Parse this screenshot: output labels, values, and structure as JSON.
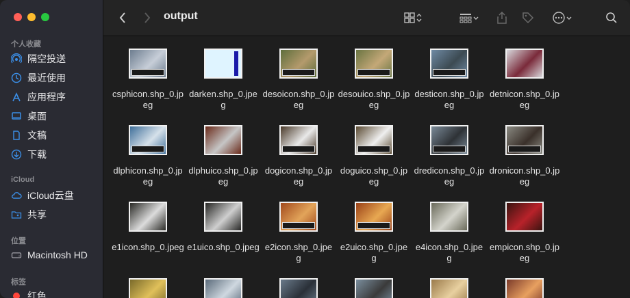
{
  "window": {
    "title": "output"
  },
  "colors": {
    "sidebar_bg": "#2a2b33",
    "content_bg": "#1e1e1e",
    "accent": "#3b8fe8",
    "tag_red": "#ff453a"
  },
  "sidebar": {
    "favorites_header": "个人收藏",
    "favorites": [
      {
        "label": "隔空投送",
        "icon": "airdrop-icon"
      },
      {
        "label": "最近使用",
        "icon": "clock-icon"
      },
      {
        "label": "应用程序",
        "icon": "applications-icon"
      },
      {
        "label": "桌面",
        "icon": "desktop-icon"
      },
      {
        "label": "文稿",
        "icon": "document-icon"
      },
      {
        "label": "下载",
        "icon": "download-icon"
      }
    ],
    "icloud_header": "iCloud",
    "icloud": [
      {
        "label": "iCloud云盘",
        "icon": "cloud-icon"
      },
      {
        "label": "共享",
        "icon": "shared-folder-icon"
      }
    ],
    "locations_header": "位置",
    "locations": [
      {
        "label": "Macintosh HD",
        "icon": "disk-icon"
      }
    ],
    "tags_header": "标签",
    "tags": [
      {
        "label": "红色",
        "icon": "tag-red-icon"
      }
    ]
  },
  "files": [
    {
      "name": "csphicon.shp_0.jpeg",
      "line1": "csphicon.shp_0.jp",
      "line2": "eg",
      "bg": "#6d7d8f",
      "fg": "#c7ced8",
      "cap": true
    },
    {
      "name": "darken.shp_0.jpeg",
      "line1": "darken.shp_0.jpe",
      "line2": "g",
      "bg": "#dff4ff",
      "fg": "#1a1aa8",
      "cap": false
    },
    {
      "name": "desoicon.shp_0.jpeg",
      "line1": "desoicon.shp_0.jp",
      "line2": "eg",
      "bg": "#5e6e3c",
      "fg": "#b49a6c",
      "cap": true
    },
    {
      "name": "desouico.shp_0.jpeg",
      "line1": "desouico.shp_0.jp",
      "line2": "eg",
      "bg": "#6a7542",
      "fg": "#c4a878",
      "cap": true
    },
    {
      "name": "desticon.shp_0.jpeg",
      "line1": "desticon.shp_0.jp",
      "line2": "eg",
      "bg": "#6f8aa4",
      "fg": "#3c4a52",
      "cap": true
    },
    {
      "name": "detnicon.shp_0.jpeg",
      "line1": "detnicon.shp_0.jp",
      "line2": "eg",
      "bg": "#d8d8dc",
      "fg": "#7a2a3a",
      "cap": false
    },
    {
      "name": "dlphicon.shp_0.jpeg",
      "line1": "dlphicon.shp_0.jp",
      "line2": "eg",
      "bg": "#3f6f9a",
      "fg": "#d6e1ea",
      "cap": true
    },
    {
      "name": "dlphuico.shp_0.jpeg",
      "line1": "dlphuico.shp_0.jp",
      "line2": "eg",
      "bg": "#6a2a1a",
      "fg": "#c6c6c6",
      "cap": false
    },
    {
      "name": "dogicon.shp_0.jpeg",
      "line1": "dogicon.shp_0.jp",
      "line2": "eg",
      "bg": "#4a3a2a",
      "fg": "#e9e9e9",
      "cap": true
    },
    {
      "name": "doguico.shp_0.jpeg",
      "line1": "doguico.shp_0.jp",
      "line2": "eg",
      "bg": "#5a4a32",
      "fg": "#efefef",
      "cap": true
    },
    {
      "name": "dredicon.shp_0.jpeg",
      "line1": "dredicon.shp_0.jp",
      "line2": "eg",
      "bg": "#7a8a98",
      "fg": "#2e3236",
      "cap": true
    },
    {
      "name": "dronicon.shp_0.jpeg",
      "line1": "dronicon.shp_0.jp",
      "line2": "eg",
      "bg": "#8a8a82",
      "fg": "#3a302a",
      "cap": true
    },
    {
      "name": "e1icon.shp_0.jpeg",
      "line1": "e1icon.shp_0.jpeg",
      "line2": "",
      "bg": "#2a2a26",
      "fg": "#dcdcdc",
      "cap": false
    },
    {
      "name": "e1uico.shp_0.jpeg",
      "line1": "e1uico.shp_0.jpeg",
      "line2": "",
      "bg": "#262624",
      "fg": "#cfcfcf",
      "cap": false
    },
    {
      "name": "e2icon.shp_0.jpeg",
      "line1": "e2icon.shp_0.jpe",
      "line2": "g",
      "bg": "#a24a1c",
      "fg": "#e2a45a",
      "cap": true
    },
    {
      "name": "e2uico.shp_0.jpeg",
      "line1": "e2uico.shp_0.jpe",
      "line2": "g",
      "bg": "#9a4218",
      "fg": "#e8a852",
      "cap": true
    },
    {
      "name": "e4icon.shp_0.jpeg",
      "line1": "e4icon.shp_0.jpe",
      "line2": "g",
      "bg": "#6a6a5a",
      "fg": "#d4d4cc",
      "cap": false
    },
    {
      "name": "empicon.shp_0.jpeg",
      "line1": "empicon.shp_0.jp",
      "line2": "eg",
      "bg": "#3a1410",
      "fg": "#b8222a",
      "cap": false
    },
    {
      "name": "",
      "line1": "",
      "line2": "",
      "bg": "#7a6a2a",
      "fg": "#e0c05a",
      "cap": false
    },
    {
      "name": "",
      "line1": "",
      "line2": "",
      "bg": "#5a6a7a",
      "fg": "#cfd8e0",
      "cap": false
    },
    {
      "name": "",
      "line1": "",
      "line2": "",
      "bg": "#6a7a8a",
      "fg": "#2a3038",
      "cap": false
    },
    {
      "name": "",
      "line1": "",
      "line2": "",
      "bg": "#7a8e9e",
      "fg": "#3a3a3a",
      "cap": false
    },
    {
      "name": "",
      "line1": "",
      "line2": "",
      "bg": "#9a7a4a",
      "fg": "#e8d0a0",
      "cap": false
    },
    {
      "name": "",
      "line1": "",
      "line2": "",
      "bg": "#7a3a2a",
      "fg": "#e8a060",
      "cap": false
    }
  ]
}
